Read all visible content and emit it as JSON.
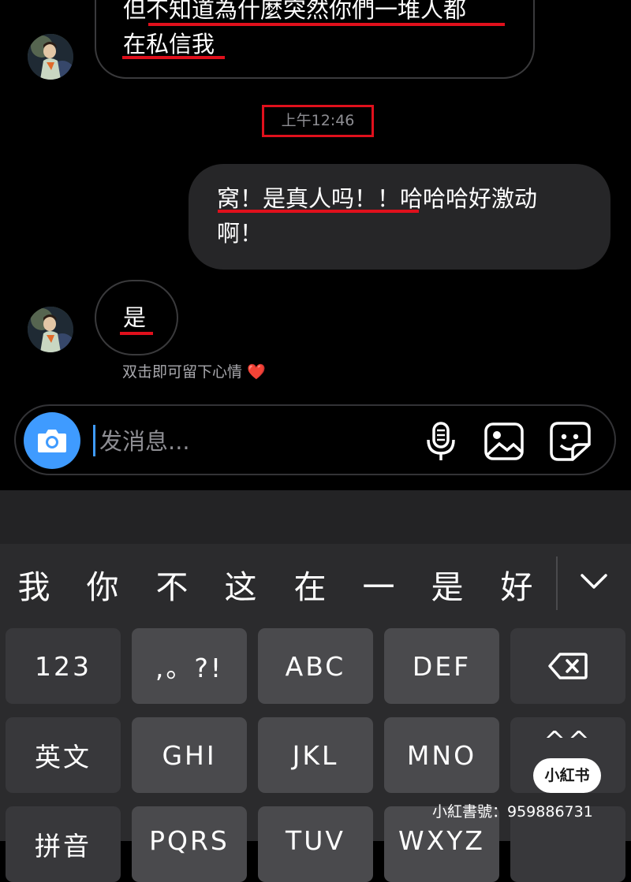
{
  "chat": {
    "messages": [
      {
        "side": "received",
        "lines": [
          "但不知道為什麼突然你們一堆人都",
          "在私信我"
        ]
      },
      {
        "side": "sent",
        "lines": [
          "窝！是真人吗！！哈哈哈好激动",
          "啊！"
        ]
      },
      {
        "side": "received",
        "lines": [
          "是"
        ]
      }
    ],
    "timestamp": "上午12:46",
    "reaction_hint": "双击即可留下心情 ❤️"
  },
  "composer": {
    "placeholder": "发消息...",
    "icons": [
      "camera-icon",
      "microphone-icon",
      "image-icon",
      "sticker-icon"
    ],
    "accent": "#3f9bff"
  },
  "keyboard": {
    "candidates": [
      "我",
      "你",
      "不",
      "这",
      "在",
      "一",
      "是",
      "好"
    ],
    "row1": [
      "123",
      ",。?!",
      "ABC",
      "DEF"
    ],
    "row2": [
      "英文",
      "GHI",
      "JKL",
      "MNO",
      "^^"
    ],
    "row3": [
      "拼音",
      "PQRS",
      "TUV",
      "WXYZ"
    ]
  },
  "watermark": {
    "logo": "小紅书",
    "id": "小紅書號：959886731"
  },
  "colors": {
    "highlight": "#e0101c",
    "sent_bubble": "#262628",
    "background": "#000000"
  }
}
